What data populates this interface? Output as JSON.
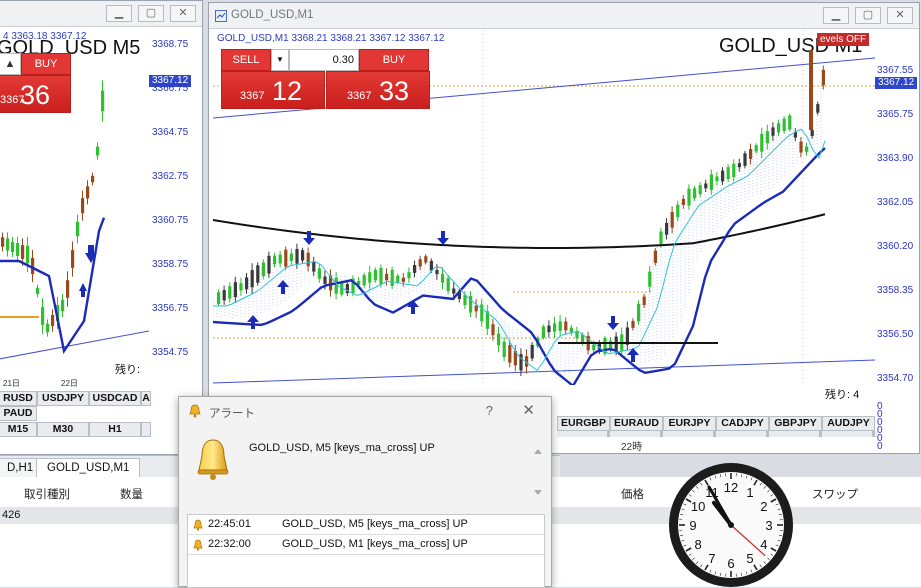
{
  "left_chart": {
    "title": "GOLD_USD,M5",
    "ohlc": "4  3363.18 3367.12",
    "symbol_big": "GOLD_USD M5",
    "buy_label": "BUY",
    "ask_small": "3367",
    "ask_large": "36",
    "price_tag": "3367.12",
    "axis": [
      "3368.75",
      "3366.75",
      "3364.75",
      "3362.75",
      "3360.75",
      "3358.75",
      "3356.75",
      "3354.75"
    ],
    "remaining": "残り:",
    "date_labels": [
      "21日",
      "22日"
    ],
    "symbols_row1": [
      "RUSD",
      "USDJPY",
      "USDCAD",
      "A"
    ],
    "symbols_row2": [
      "PAUD",
      "",
      "",
      ""
    ],
    "timeframes": [
      "M15",
      "M30",
      "H1",
      ""
    ]
  },
  "main_chart": {
    "title": "GOLD_USD,M1",
    "ohlc": "GOLD_USD,M1  3368.21 3368.21 3367.12 3367.12",
    "symbol_big": "GOLD_USD M1",
    "levels_label": "evels OFF",
    "sell_label": "SELL",
    "buy_label": "BUY",
    "lot": "0.30",
    "bid_small": "3367",
    "bid_large": "12",
    "ask_small": "3367",
    "ask_large": "33",
    "price_tag": "3367.12",
    "axis": [
      "3367.55",
      "3365.75",
      "3363.90",
      "3362.05",
      "3360.20",
      "3358.35",
      "3356.50",
      "3354.70"
    ],
    "remaining": "残り: 4",
    "right_axis_small": [
      "0",
      "0",
      "0",
      "0",
      "0",
      "0"
    ],
    "symbols": [
      "EURGBP",
      "EURAUD",
      "EURJPY",
      "CADJPY",
      "GBPJPY",
      "AUDJPY"
    ],
    "time_label": "22時"
  },
  "tabs": [
    "D,H1",
    "GOLD_USD,M1"
  ],
  "terminal": {
    "headers": [
      "取引種別",
      "数量",
      "価格",
      "スワップ"
    ],
    "row_text": "426"
  },
  "alert": {
    "title": "アラート",
    "help": "?",
    "close": "✕",
    "message": "GOLD_USD, M5 [keys_ma_cross] UP",
    "rows": [
      {
        "time": "22:45:01",
        "text": "GOLD_USD, M5 [keys_ma_cross] UP"
      },
      {
        "time": "22:32:00",
        "text": "GOLD_USD, M1 [keys_ma_cross] UP"
      }
    ]
  },
  "clock": {
    "numbers": [
      "12",
      "1",
      "2",
      "3",
      "4",
      "5",
      "6",
      "7",
      "8",
      "9",
      "10",
      "11"
    ],
    "hour": 10.75,
    "minute": 55,
    "second": 22
  },
  "colors": {
    "accent_red": "#e23734",
    "axis_blue": "#2a37c0",
    "ma_blue": "#1a2bb8",
    "candle_green": "#2fbf2f",
    "candle_brown": "#9a4a1a"
  }
}
